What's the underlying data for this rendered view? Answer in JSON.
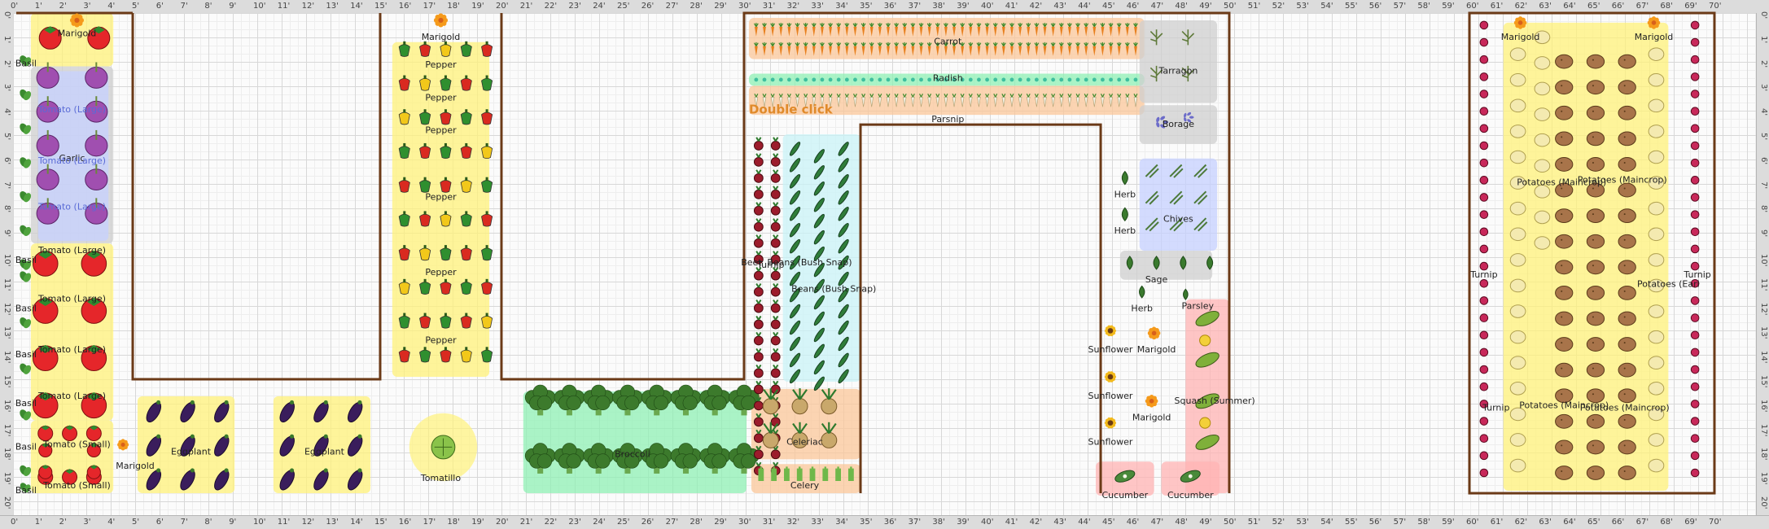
{
  "ruler": {
    "ticks": [
      "0'",
      "1'",
      "2'",
      "3'",
      "4'",
      "5'",
      "6'",
      "7'",
      "8'",
      "9'",
      "10'",
      "11'",
      "12'",
      "13'",
      "14'",
      "15'",
      "16'",
      "17'",
      "18'",
      "19'",
      "20'",
      "21'",
      "22'",
      "23'",
      "24'",
      "25'",
      "26'",
      "27'",
      "28'",
      "29'",
      "30'",
      "31'",
      "32'",
      "33'",
      "34'",
      "35'",
      "36'",
      "37'",
      "38'",
      "39'",
      "40'",
      "41'",
      "42'",
      "43'",
      "44'",
      "45'",
      "46'",
      "47'",
      "48'",
      "49'",
      "50'",
      "51'",
      "52'",
      "53'",
      "54'",
      "55'",
      "56'",
      "57'",
      "58'",
      "59'",
      "60'",
      "61'",
      "62'",
      "63'",
      "64'",
      "65'",
      "66'",
      "67'",
      "68'",
      "69'",
      "70'"
    ],
    "vticks": [
      "0'",
      "1'",
      "2'",
      "3'",
      "4'",
      "5'",
      "6'",
      "7'",
      "8'",
      "9'",
      "10'",
      "11'",
      "12'",
      "13'",
      "14'",
      "15'",
      "16'",
      "17'",
      "18'",
      "19'",
      "20'"
    ]
  },
  "hint": "Double click",
  "colors": {
    "bed_border": "#6b3a17",
    "highlight_yellow": "#fff27a",
    "highlight_blue": "#c6d0ff",
    "highlight_grey": "#cfcfcf",
    "highlight_orange": "#fbc79a",
    "highlight_green": "#8ff0b4",
    "highlight_red": "#ffb3b3",
    "highlight_cyan": "#c9f3f7",
    "hint_color": "#e08a2a"
  },
  "plants": [
    {
      "name": "Marigold",
      "icon": "marigold-icon"
    },
    {
      "name": "Basil",
      "icon": "basil-icon"
    },
    {
      "name": "Tomato (Large)",
      "icon": "tomato-icon"
    },
    {
      "name": "Garlic",
      "icon": "garlic-icon"
    },
    {
      "name": "Tomato (Small)",
      "icon": "tomato-small-icon"
    },
    {
      "name": "Eggplant",
      "icon": "eggplant-icon"
    },
    {
      "name": "Pepper",
      "icon": "pepper-icon"
    },
    {
      "name": "Tomatillo",
      "icon": "tomatillo-icon"
    },
    {
      "name": "Broccoli",
      "icon": "broccoli-icon"
    },
    {
      "name": "Carrot",
      "icon": "carrot-icon"
    },
    {
      "name": "Radish",
      "icon": "radish-icon"
    },
    {
      "name": "Parsnip",
      "icon": "parsnip-icon"
    },
    {
      "name": "Beet",
      "icon": "beet-icon"
    },
    {
      "name": "Turnip",
      "icon": "turnip-icon"
    },
    {
      "name": "Beans (Bush Snap)",
      "icon": "bean-icon"
    },
    {
      "name": "Celeriac",
      "icon": "celeriac-icon"
    },
    {
      "name": "Celery",
      "icon": "celery-icon"
    },
    {
      "name": "Tarragon",
      "icon": "tarragon-icon"
    },
    {
      "name": "Borage",
      "icon": "borage-icon"
    },
    {
      "name": "Herb",
      "icon": "herb-icon"
    },
    {
      "name": "Chives",
      "icon": "chives-icon"
    },
    {
      "name": "Sage",
      "icon": "sage-icon"
    },
    {
      "name": "Parsley",
      "icon": "parsley-icon"
    },
    {
      "name": "Sunflower",
      "icon": "sunflower-icon"
    },
    {
      "name": "Squash (Summer)",
      "icon": "squash-icon"
    },
    {
      "name": "Cucumber",
      "icon": "cucumber-icon"
    },
    {
      "name": "Potatoes (Earl",
      "icon": "potato-early-icon"
    },
    {
      "name": "Potatoes (Maincrop)",
      "icon": "potato-main-icon"
    }
  ]
}
